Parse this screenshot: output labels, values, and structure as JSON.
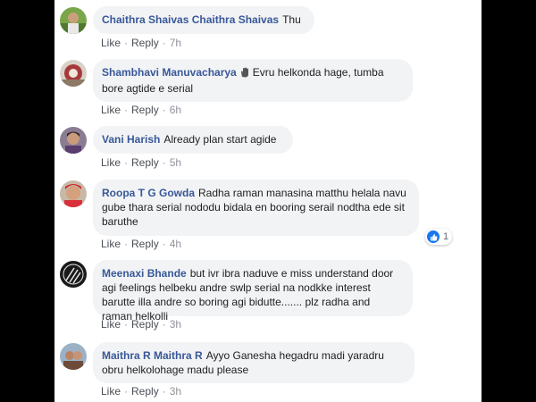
{
  "action_labels": {
    "like": "Like",
    "reply": "Reply",
    "separator": "·"
  },
  "comments": [
    {
      "name": "Chaithra Shaivas Chaithra Shaivas",
      "text": "Thu",
      "time": "7h"
    },
    {
      "name": "Shambhavi Manuvacharya",
      "badge_icon": "waving-hand-icon",
      "text": "Evru helkonda hage, tumba bore agtide e serial",
      "time": "6h"
    },
    {
      "name": "Vani Harish",
      "text": "Already plan start agide",
      "time": "5h"
    },
    {
      "name": "Roopa T G Gowda",
      "text": "Radha raman manasina matthu helala navu gube thara serial nododu bidala en booring serail nodtha ede sit baruthe",
      "time": "4h",
      "reaction": {
        "icon": "like-icon",
        "count": "1"
      }
    },
    {
      "name": "Meenaxi Bhande",
      "text": "but ivr ibra naduve e miss understand door agi feelings helbeku andre swlp serial na nodkke interest barutte illa andre so boring agi bidutte....... plz radha and raman helkolli",
      "time": "3h"
    },
    {
      "name": "Maithra R Maithra R",
      "text": "Ayyo Ganesha hegadru madi yaradru obru helkolohage madu please",
      "time": "3h"
    }
  ],
  "colors": {
    "name": "#385898",
    "bubble": "#f2f3f5",
    "text": "#1c1e21",
    "meta": "#90949c",
    "like_blue": "#1877f2",
    "frame": "#000000"
  }
}
